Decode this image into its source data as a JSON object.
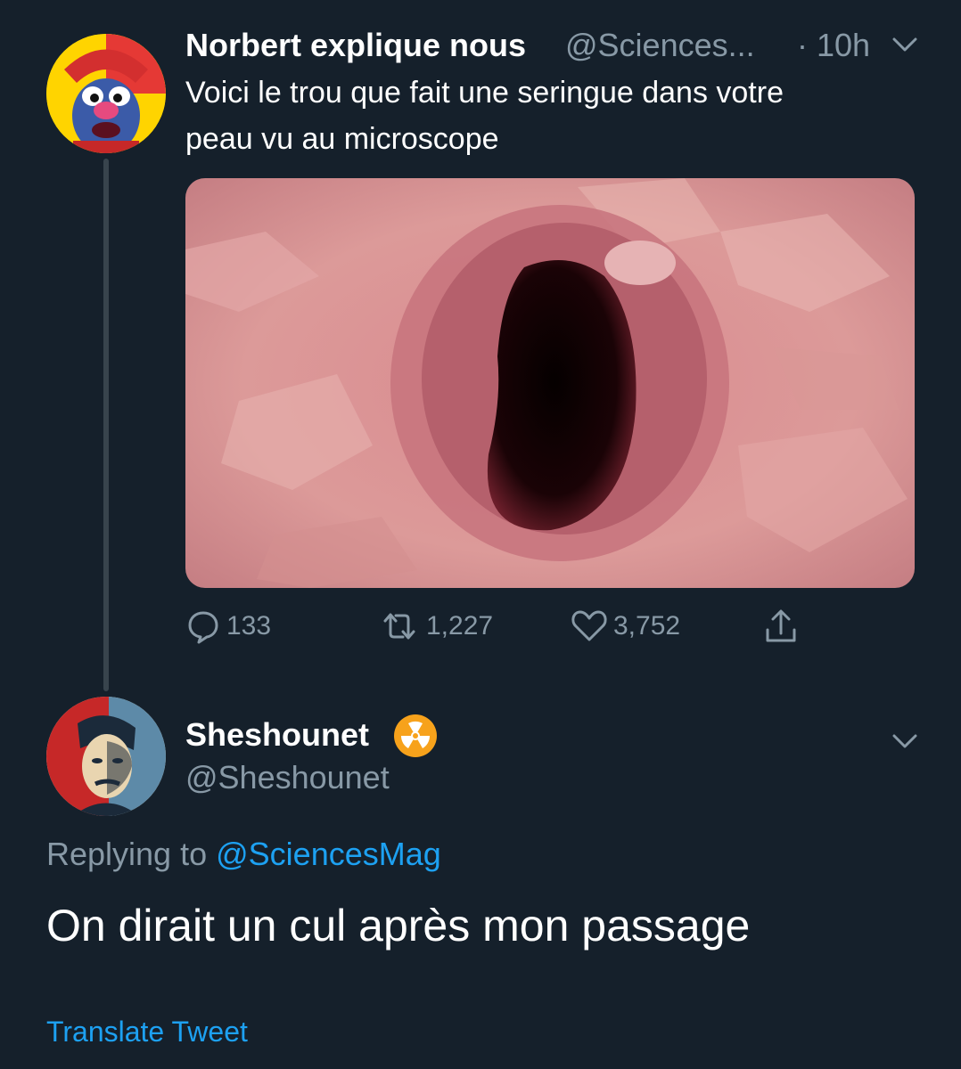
{
  "tweet": {
    "author_name": "Norbert explique nous",
    "author_handle": "@Sciences...",
    "time": "· 10h",
    "text_line1": "Voici le trou que fait une seringue dans votre",
    "text_line2": "peau vu au microscope",
    "media_description_icon": "microscope-skin-photo",
    "stats": {
      "replies": "133",
      "retweets": "1,227",
      "likes": "3,752"
    }
  },
  "reply": {
    "author_name": "Sheshounet",
    "badge_icon": "radioactive-icon",
    "author_handle": "@Sheshounet",
    "replying_prefix": "Replying to",
    "replying_to": "@SciencesMag",
    "text": "On dirait un cul après mon passage",
    "translate_label": "Translate Tweet"
  },
  "colors": {
    "background": "#15202b",
    "secondary_text": "#8899a6",
    "link": "#1da1f2",
    "thread_line": "#38444d"
  }
}
